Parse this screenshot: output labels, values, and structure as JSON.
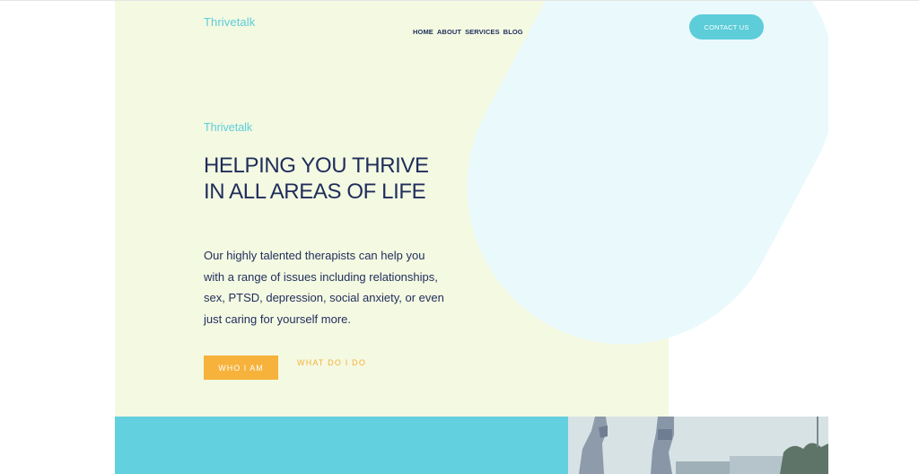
{
  "header": {
    "logo": "Thrivetalk",
    "nav": [
      "HOME",
      "ABOUT",
      "SERVICES",
      "BLOG"
    ],
    "contact_label": "CONTACT US"
  },
  "hero": {
    "eyebrow": "Thrivetalk",
    "headline_lines": [
      "HELPING YOU THRIVE",
      "IN ALL AREAS OF LIFE"
    ],
    "body_lines": [
      "Our highly talented therapists can help you",
      "with a range of issues including relationships,",
      "sex, PTSD, depression, social anxiety, or even",
      "just caring for yourself more."
    ],
    "primary_cta": "WHO I AM",
    "secondary_cta": "WHAT DO I DO"
  },
  "colors": {
    "hero_background": "#f4f9e2",
    "blob": "#e9f9fc",
    "accent_teal": "#5ccdd9",
    "accent_orange": "#f6b23a",
    "navy_text": "#1f2d5a",
    "band_teal": "#62d0de"
  }
}
